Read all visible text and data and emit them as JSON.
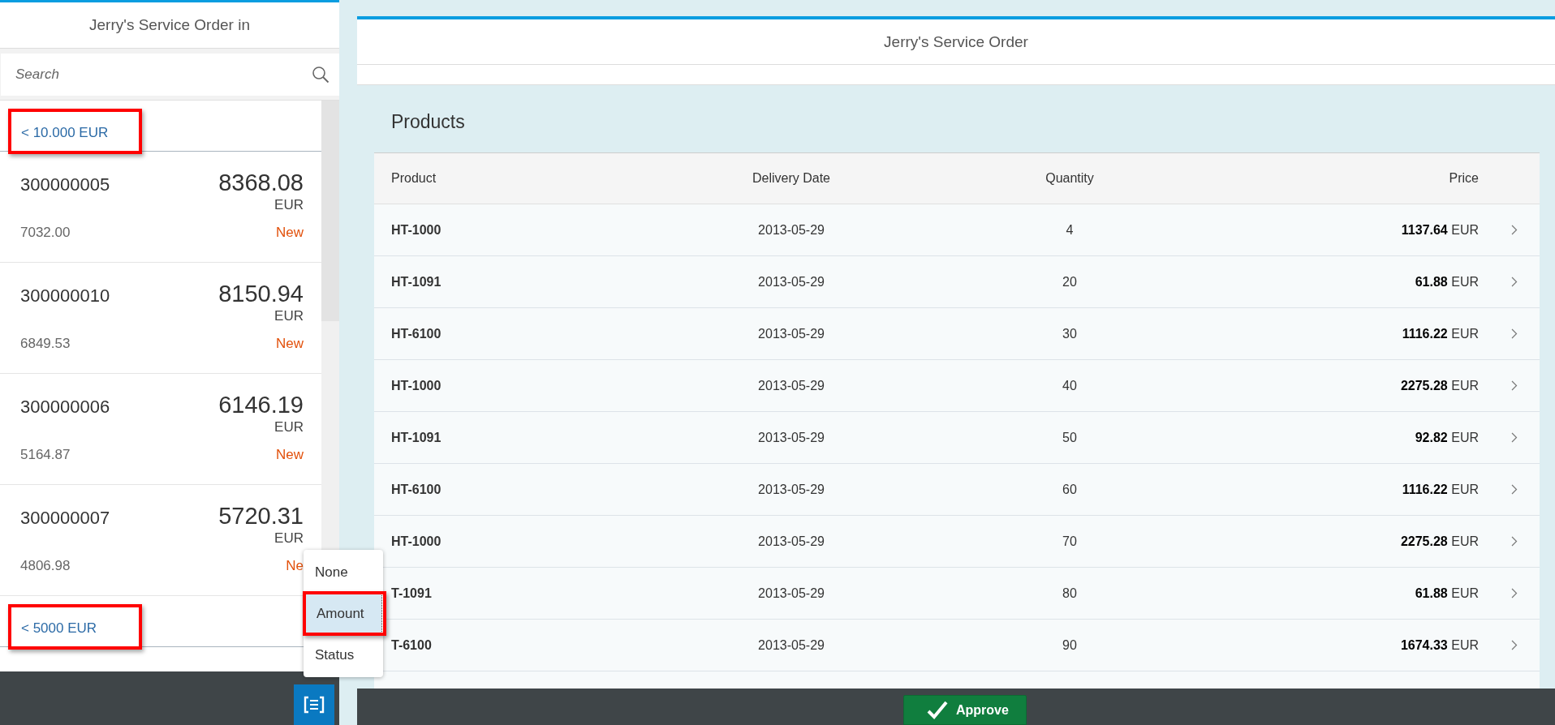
{
  "master": {
    "title": "Jerry's Service Order in",
    "search": {
      "placeholder": "Search"
    },
    "groups": [
      {
        "title": "< 10.000 EUR",
        "highlighted": true,
        "items": [
          {
            "number": "300000005",
            "amount": "8368.08",
            "currency": "EUR",
            "secondary": "7032.00",
            "status": "New"
          },
          {
            "number": "300000010",
            "amount": "8150.94",
            "currency": "EUR",
            "secondary": "6849.53",
            "status": "New"
          },
          {
            "number": "300000006",
            "amount": "6146.19",
            "currency": "EUR",
            "secondary": "5164.87",
            "status": "New"
          },
          {
            "number": "300000007",
            "amount": "5720.31",
            "currency": "EUR",
            "secondary": "4806.98",
            "status": "Ne"
          }
        ]
      },
      {
        "title": "< 5000 EUR",
        "highlighted": true
      }
    ]
  },
  "group_menu": {
    "options": [
      {
        "label": "None",
        "selected": false,
        "highlighted": false
      },
      {
        "label": "Amount",
        "selected": true,
        "highlighted": true
      },
      {
        "label": "Status",
        "selected": false,
        "highlighted": false
      }
    ]
  },
  "detail": {
    "title": "Jerry's Service Order",
    "section_title": "Products",
    "table": {
      "columns": [
        "Product",
        "Delivery Date",
        "Quantity",
        "Price"
      ],
      "rows": [
        {
          "product": "HT-1000",
          "date": "2013-05-29",
          "quantity": "4",
          "price": "1137.64",
          "currency": "EUR"
        },
        {
          "product": "HT-1091",
          "date": "2013-05-29",
          "quantity": "20",
          "price": "61.88",
          "currency": "EUR"
        },
        {
          "product": "HT-6100",
          "date": "2013-05-29",
          "quantity": "30",
          "price": "1116.22",
          "currency": "EUR"
        },
        {
          "product": "HT-1000",
          "date": "2013-05-29",
          "quantity": "40",
          "price": "2275.28",
          "currency": "EUR"
        },
        {
          "product": "HT-1091",
          "date": "2013-05-29",
          "quantity": "50",
          "price": "92.82",
          "currency": "EUR"
        },
        {
          "product": "HT-6100",
          "date": "2013-05-29",
          "quantity": "60",
          "price": "1116.22",
          "currency": "EUR"
        },
        {
          "product": "HT-1000",
          "date": "2013-05-29",
          "quantity": "70",
          "price": "2275.28",
          "currency": "EUR"
        },
        {
          "product": "T-1091",
          "date": "2013-05-29",
          "quantity": "80",
          "price": "61.88",
          "currency": "EUR"
        },
        {
          "product": "T-6100",
          "date": "2013-05-29",
          "quantity": "90",
          "price": "1674.33",
          "currency": "EUR"
        }
      ]
    }
  },
  "footer": {
    "approve": "Approve"
  }
}
